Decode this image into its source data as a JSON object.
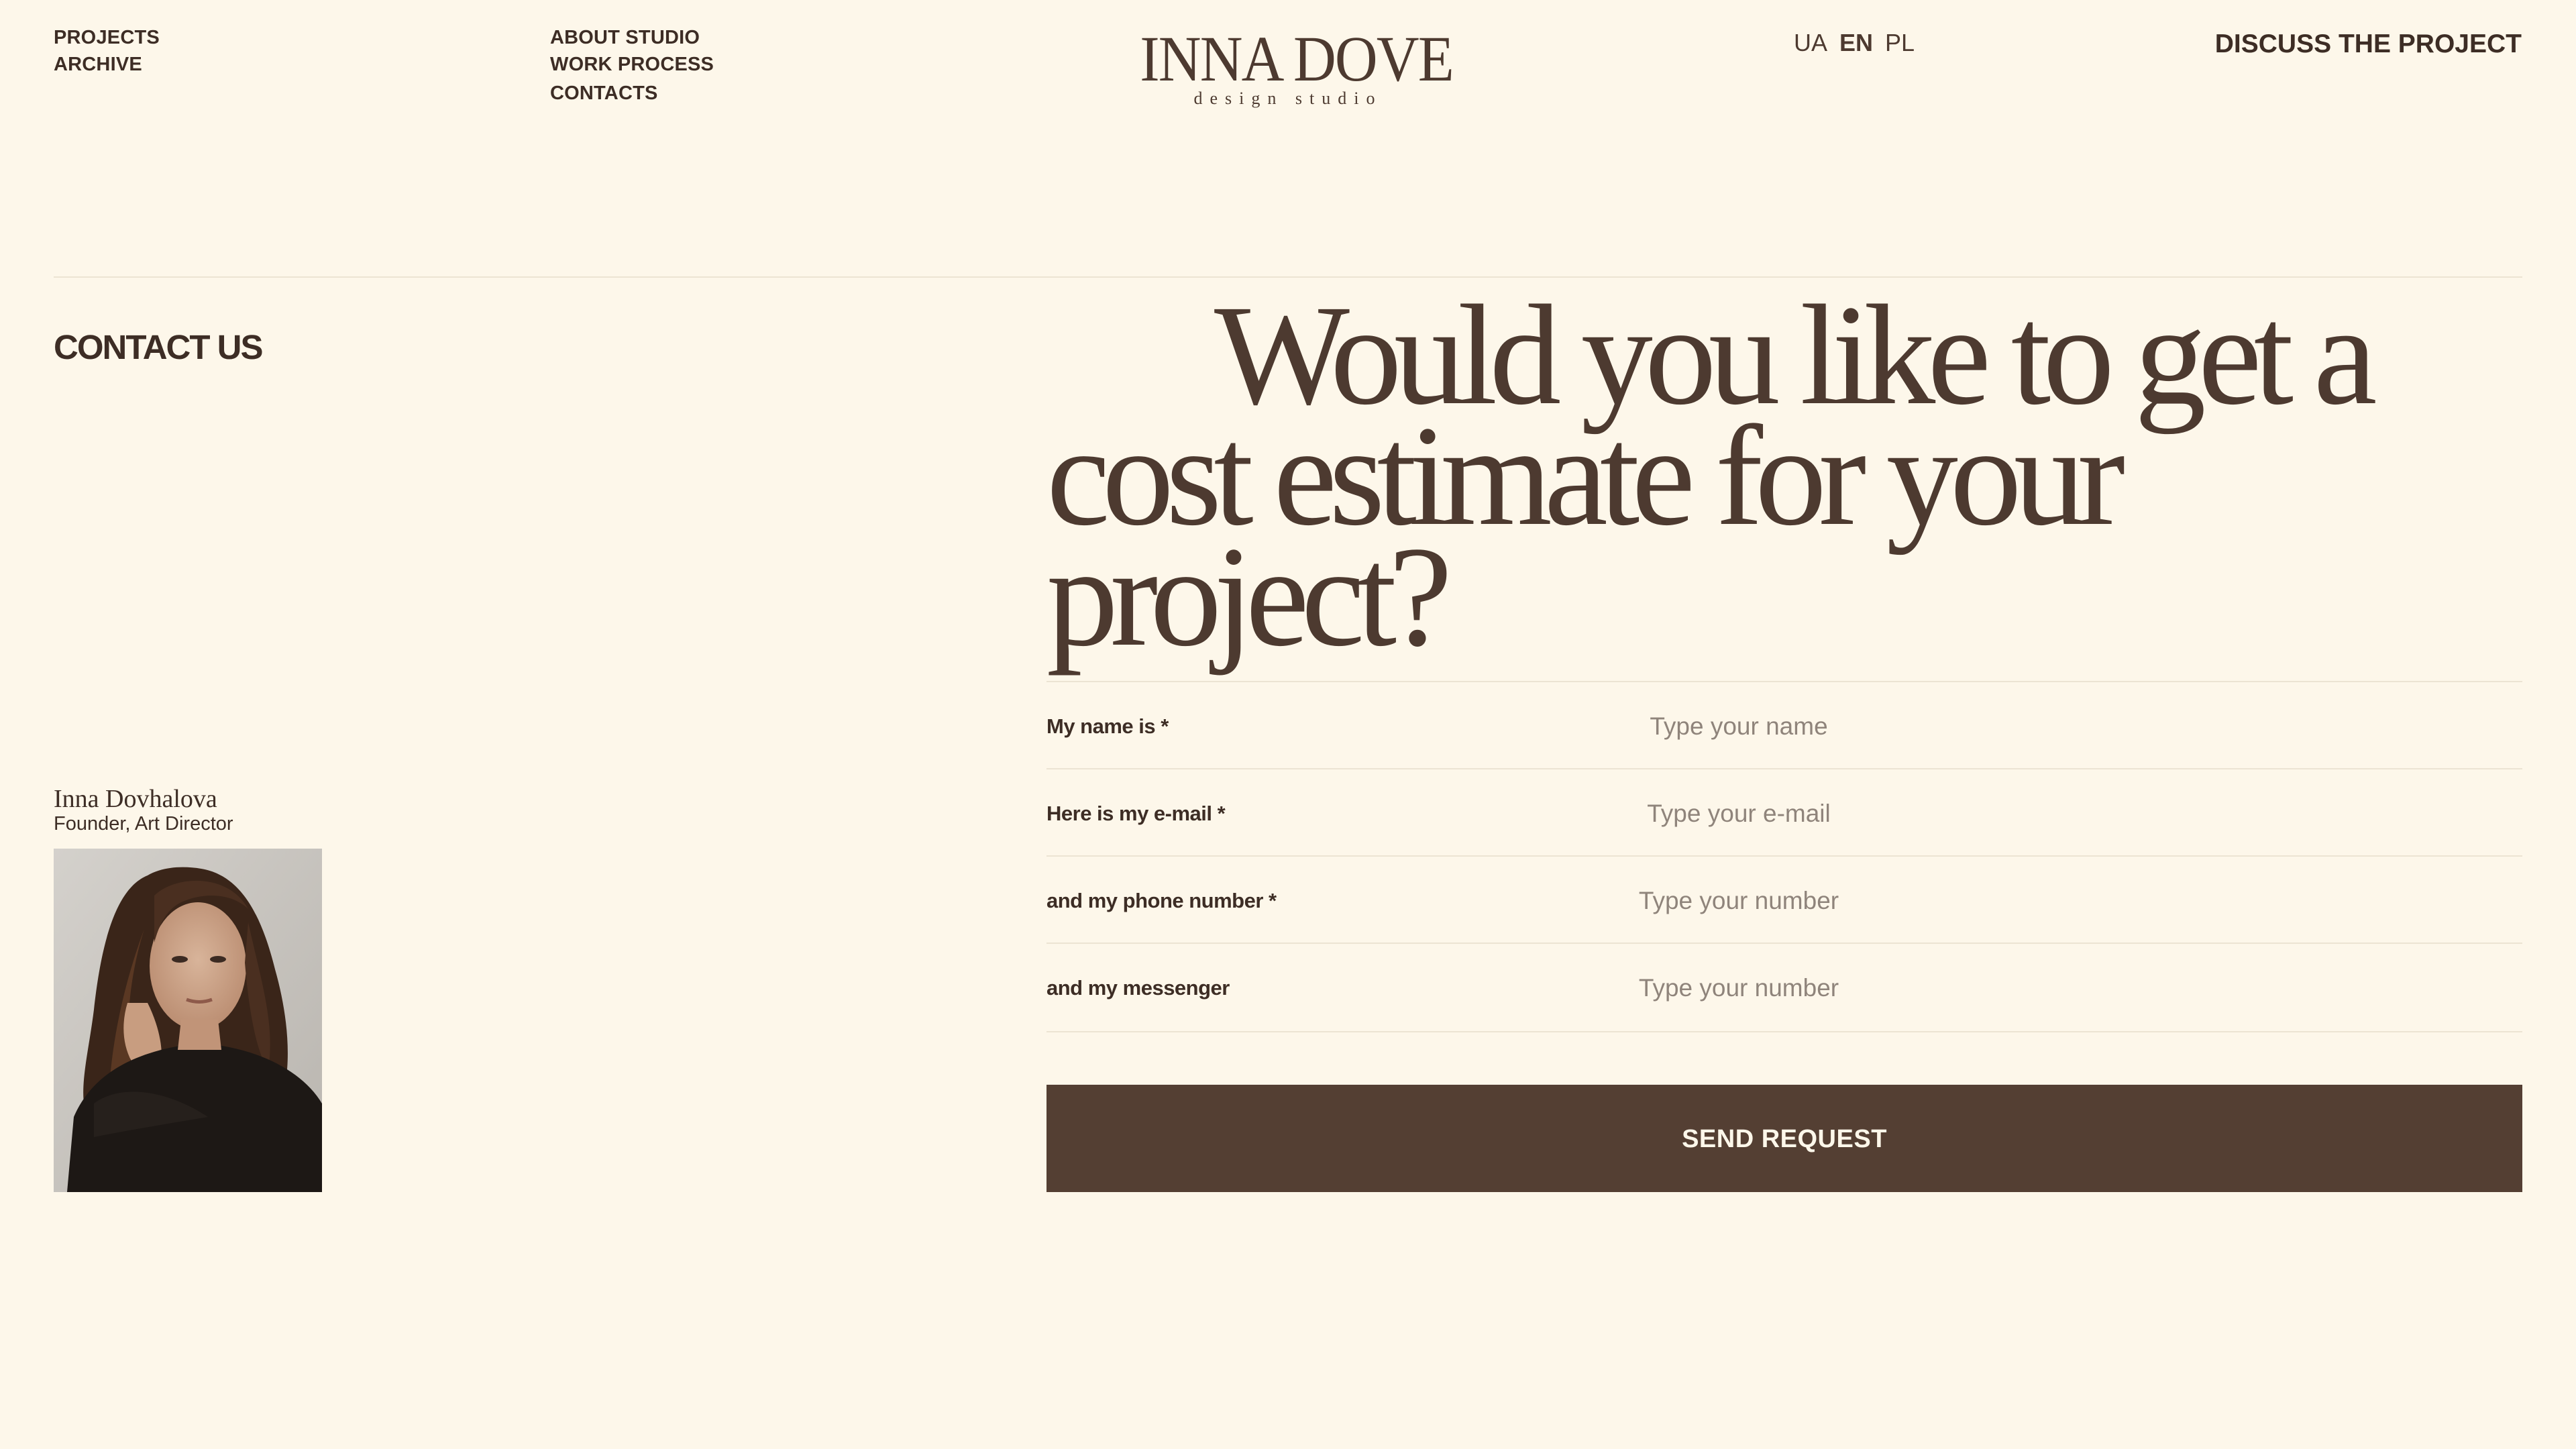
{
  "header": {
    "nav_left": [
      "PROJECTS",
      "ARCHIVE"
    ],
    "nav_middle": [
      "ABOUT STUDIO",
      "WORK PROCESS",
      "CONTACTS"
    ],
    "logo_title": "INNA DOVE",
    "logo_subtitle": "design studio",
    "languages": [
      "UA",
      "EN",
      "PL"
    ],
    "active_language": "EN",
    "cta_label": "DISCUSS THE PROJECT"
  },
  "main": {
    "section_title": "CONTACT US",
    "headline": "Would you like to get a cost estimate for your project?",
    "founder": {
      "name": "Inna Dovhalova",
      "role": "Founder, Art Director"
    },
    "form": {
      "fields": [
        {
          "label": "My name is *",
          "placeholder": "Type your name",
          "value": ""
        },
        {
          "label": "Here is my e-mail *",
          "placeholder": "Type your e-mail",
          "value": ""
        },
        {
          "label": "and my phone number *",
          "placeholder": "Type your number",
          "value": ""
        },
        {
          "label": "and my messenger",
          "placeholder": "Type your number",
          "value": ""
        }
      ],
      "submit_label": "SEND REQUEST"
    }
  },
  "colors": {
    "background": "#fdf7ea",
    "text": "#3d2d25",
    "headline": "#4d3a30",
    "button": "#543f33",
    "divider": "#ece4d3"
  }
}
